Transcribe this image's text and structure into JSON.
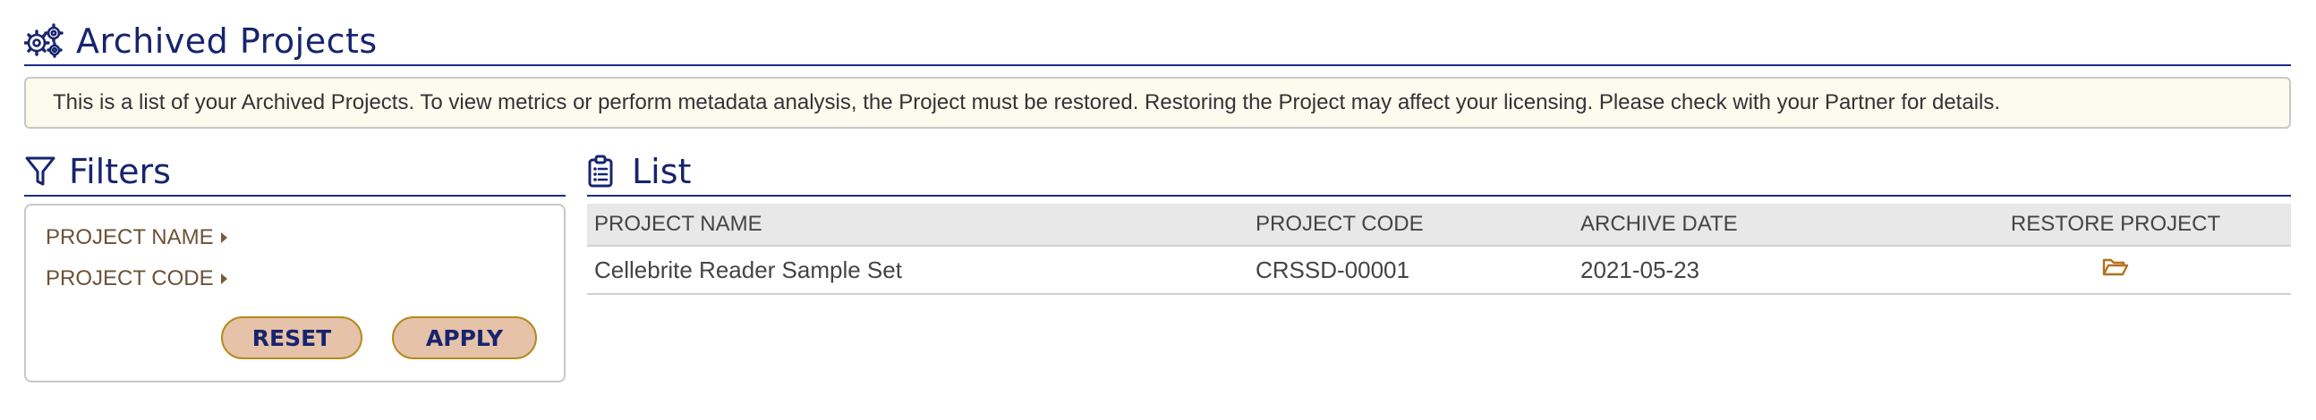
{
  "header": {
    "title": "Archived Projects",
    "icon": "gears-icon"
  },
  "info_banner": {
    "text": "This is a list of your Archived Projects. To view metrics or perform metadata analysis, the Project must be restored. Restoring the Project may affect your licensing. Please check with your Partner for details."
  },
  "filters": {
    "title": "Filters",
    "icon": "funnel-icon",
    "items": [
      {
        "label": "PROJECT NAME",
        "icon": "caret-right-icon"
      },
      {
        "label": "PROJECT CODE",
        "icon": "caret-right-icon"
      }
    ],
    "reset_label": "RESET",
    "apply_label": "APPLY"
  },
  "list": {
    "title": "List",
    "icon": "clipboard-list-icon",
    "columns": [
      "PROJECT NAME",
      "PROJECT CODE",
      "ARCHIVE DATE",
      "RESTORE PROJECT"
    ],
    "rows": [
      {
        "project_name": "Cellebrite Reader Sample Set",
        "project_code": "CRSSD-00001",
        "archive_date": "2021-05-23",
        "restore_icon": "folder-open-icon"
      }
    ]
  },
  "colors": {
    "heading_navy": "#17246e",
    "rule_blue": "#1c2b8a",
    "banner_bg": "#fdfaee",
    "button_fill": "#e5c2a8",
    "button_border": "#b48a1e",
    "filter_text": "#6b5236",
    "restore_icon": "#b5701e"
  }
}
